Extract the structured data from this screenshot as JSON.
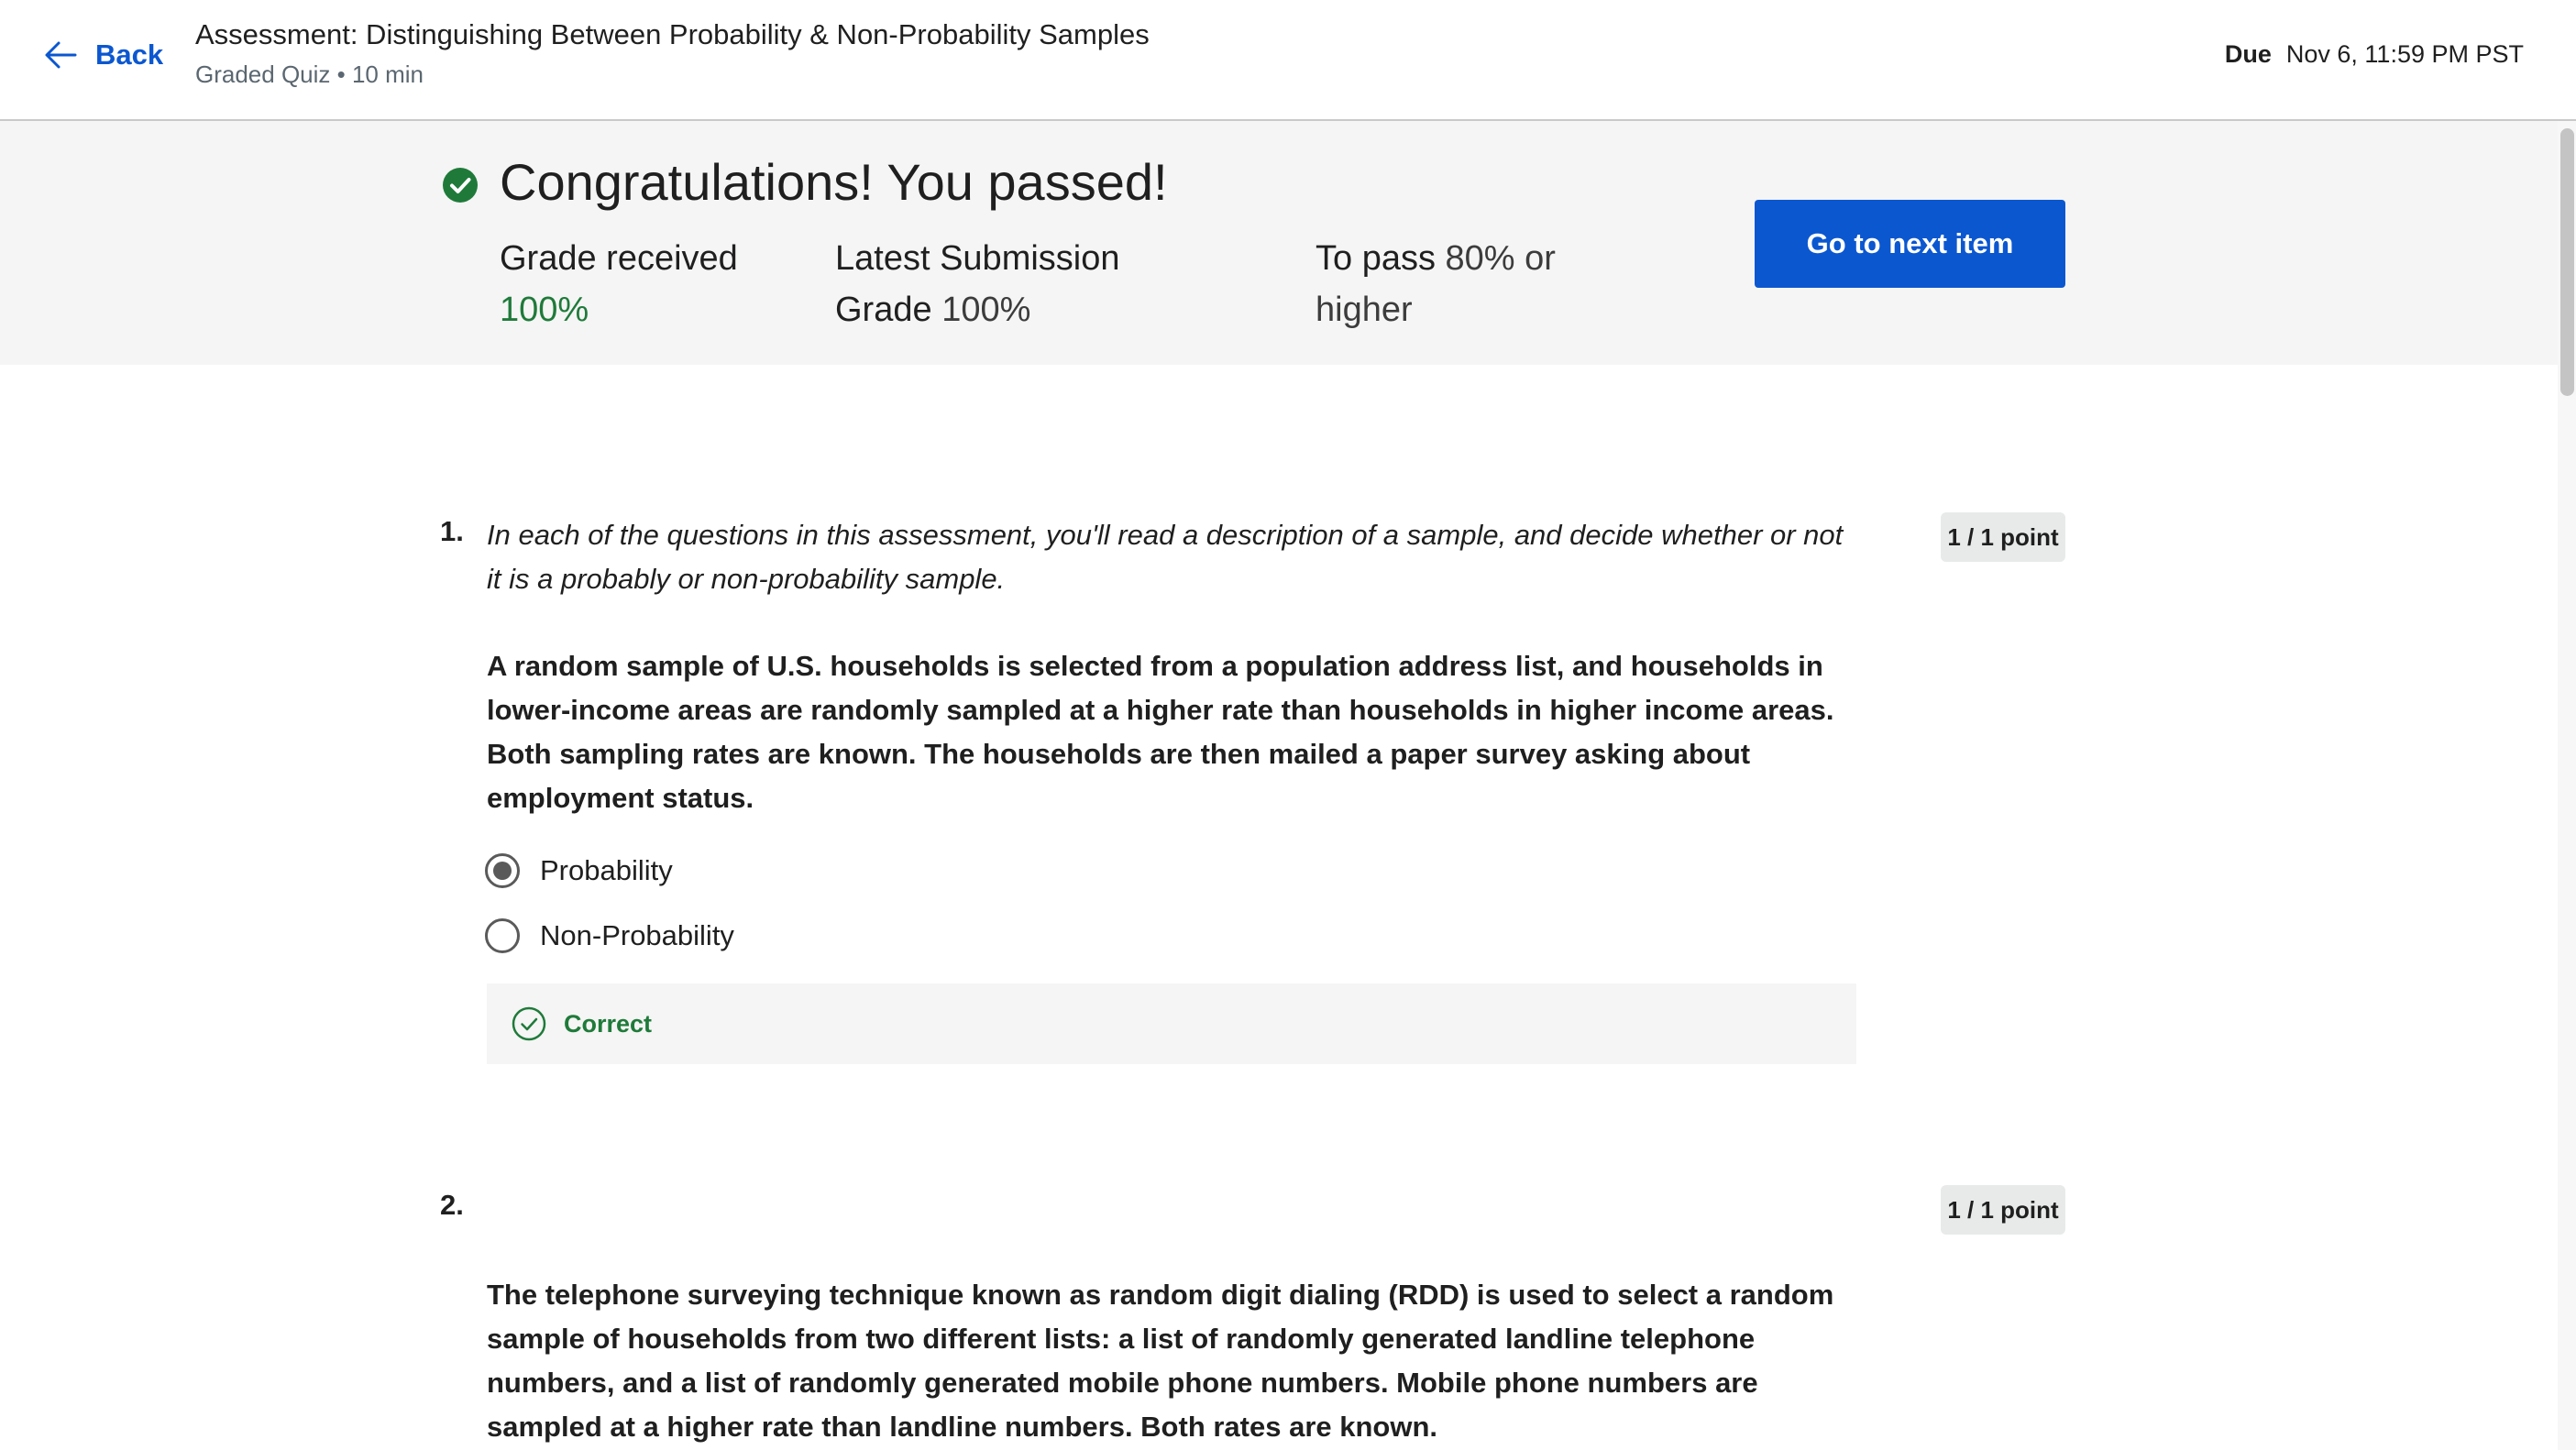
{
  "header": {
    "back_label": "Back",
    "title": "Assessment: Distinguishing Between Probability & Non-Probability Samples",
    "subtitle": "Graded Quiz • 10 min",
    "due_label": "Due",
    "due_value": "Nov 6, 11:59 PM PST"
  },
  "result": {
    "title": "Congratulations! You passed!",
    "grade_received_label": "Grade received",
    "grade_received_value": "100%",
    "latest_submission_label": "Latest Submission Grade",
    "latest_submission_value": "100%",
    "to_pass_label": "To pass",
    "to_pass_value": "80% or higher",
    "next_button": "Go to next item"
  },
  "questions": [
    {
      "number": "1.",
      "points": "1 / 1 point",
      "intro": "In each of the questions in this assessment, you'll read a description of a sample, and decide whether or not it is a probably or non-probability sample.",
      "body": "A random sample of U.S. households is selected from a population address list, and households in lower-income areas are randomly sampled at a higher rate than households in higher income areas. Both sampling rates are known. The households are then mailed a paper survey asking about employment status.",
      "options": [
        {
          "label": "Probability",
          "selected": true
        },
        {
          "label": "Non-Probability",
          "selected": false
        }
      ],
      "feedback": "Correct"
    },
    {
      "number": "2.",
      "points": "1 / 1 point",
      "body": "The telephone surveying technique known as random digit dialing (RDD) is used to select a random sample of households from two different lists: a list of randomly generated landline telephone numbers, and a list of randomly generated mobile phone numbers. Mobile phone numbers are sampled at a higher rate than landline numbers. Both rates are known."
    }
  ],
  "colors": {
    "accent": "#0b57d0",
    "success": "#1f7a3a",
    "banner_bg": "#f4f5f4"
  },
  "icons": {
    "back": "arrow-left-icon",
    "passed": "check-circle-filled-icon",
    "correct": "check-circle-outline-icon"
  }
}
